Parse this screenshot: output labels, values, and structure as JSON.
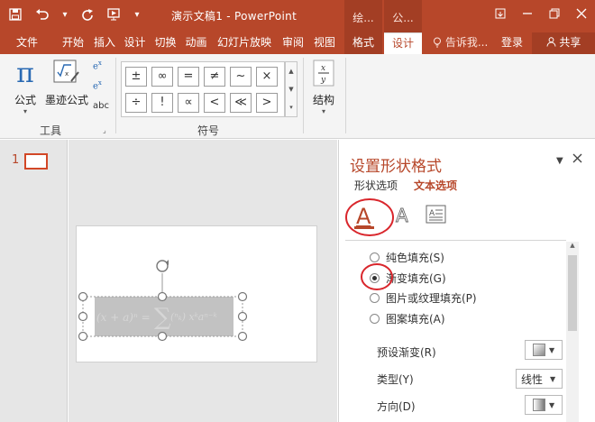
{
  "window": {
    "title": "演示文稿1 - PowerPoint"
  },
  "contextual_tabs": [
    {
      "label": "绘..."
    },
    {
      "label": "公..."
    }
  ],
  "tabs": [
    {
      "label": "文件"
    },
    {
      "label": "开始"
    },
    {
      "label": "插入"
    },
    {
      "label": "设计"
    },
    {
      "label": "切换"
    },
    {
      "label": "动画"
    },
    {
      "label": "幻灯片放映"
    },
    {
      "label": "审阅"
    },
    {
      "label": "视图"
    },
    {
      "label": "格式"
    },
    {
      "label": "设计"
    }
  ],
  "tell_me": "告诉我...",
  "login": "登录",
  "share": "共享",
  "ribbon": {
    "tools_group": {
      "label": "工具",
      "equation": "公式",
      "ink_equation": "墨迹公式",
      "abc": "abc"
    },
    "symbols_group": {
      "label": "符号",
      "symbols": [
        "±",
        "∞",
        "=",
        "≠",
        "~",
        "×",
        "÷",
        "!",
        "∝",
        "<",
        "≪",
        ">"
      ]
    },
    "structure_group": {
      "label": "结构"
    }
  },
  "slide_number": "1",
  "format_pane": {
    "title": "设置形状格式",
    "tab_shape_options": "形状选项",
    "tab_text_options": "文本选项",
    "fill_options": [
      {
        "label": "纯色填充(S)",
        "selected": false
      },
      {
        "label": "渐变填充(G)",
        "selected": true
      },
      {
        "label": "图片或纹理填充(P)",
        "selected": false
      },
      {
        "label": "图案填充(A)",
        "selected": false
      }
    ],
    "preset_gradient_label": "预设渐变(R)",
    "type_label": "类型(Y)",
    "type_value": "线性",
    "direction_label": "方向(D)"
  },
  "colors": {
    "accent": "#b7472a",
    "annotation": "#d9262c"
  }
}
